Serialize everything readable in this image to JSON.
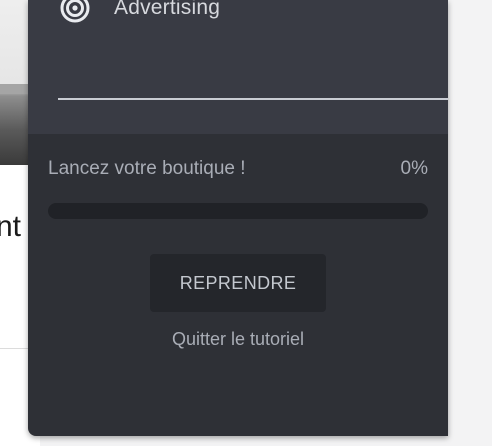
{
  "background": {
    "partial_heading_text": "nt"
  },
  "tutorial_panel": {
    "menu_item": {
      "label": "Advertising",
      "icon": "target-icon"
    },
    "progress": {
      "label": "Lancez votre boutique !",
      "percent_text": "0%",
      "value_fraction": 0
    },
    "resume_button_label": "REPRENDRE",
    "quit_link_label": "Quitter le tutoriel"
  },
  "colors": {
    "panel_background": "#2e3036",
    "panel_header_background": "#393b44",
    "progress_track": "#202227",
    "button_background": "#24262b",
    "muted_text": "#a9adb6"
  }
}
